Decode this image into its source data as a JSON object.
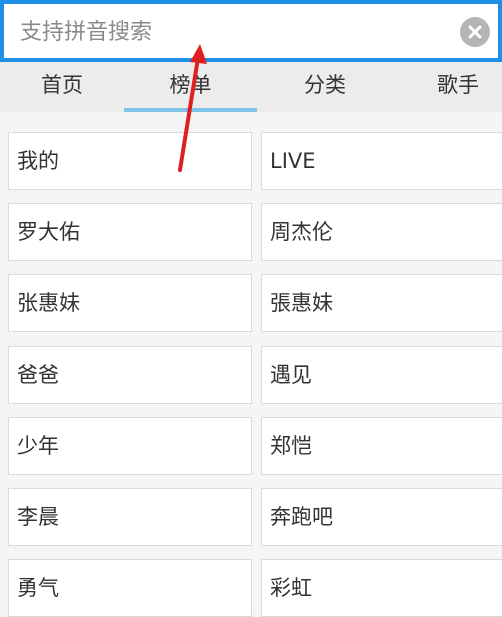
{
  "search": {
    "placeholder": "支持拼音搜索"
  },
  "tabs": [
    {
      "label": "首页"
    },
    {
      "label": "榜单"
    },
    {
      "label": "分类"
    },
    {
      "label": "歌手"
    }
  ],
  "active_tab_index": 1,
  "colors": {
    "accent": "#1e90e6",
    "tab_indicator": "#7ec3ea",
    "annotation_arrow": "#e02020"
  },
  "grid": {
    "items": [
      {
        "label": "我的"
      },
      {
        "label": "LIVE"
      },
      {
        "label": "罗大佑"
      },
      {
        "label": "周杰伦"
      },
      {
        "label": "张惠妹"
      },
      {
        "label": "張惠妹"
      },
      {
        "label": "爸爸"
      },
      {
        "label": "遇见"
      },
      {
        "label": "少年"
      },
      {
        "label": "郑恺"
      },
      {
        "label": "李晨"
      },
      {
        "label": "奔跑吧"
      },
      {
        "label": "勇气"
      },
      {
        "label": "彩虹"
      }
    ]
  }
}
